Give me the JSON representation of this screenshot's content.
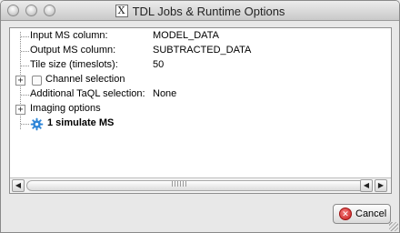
{
  "window": {
    "title": "TDL Jobs & Runtime Options",
    "title_icon": "X"
  },
  "tree": {
    "rows": [
      {
        "label": "Input MS column:",
        "value": "MODEL_DATA",
        "type": "leaf"
      },
      {
        "label": "Output MS column:",
        "value": "SUBTRACTED_DATA",
        "type": "leaf"
      },
      {
        "label": "Tile size (timeslots):",
        "value": "50",
        "type": "leaf"
      },
      {
        "label": "Channel selection",
        "type": "group-checkbox",
        "checked": false,
        "expander": "+"
      },
      {
        "label": "Additional TaQL selection:",
        "value": "None",
        "type": "leaf"
      },
      {
        "label": "Imaging options",
        "type": "group",
        "expander": "+"
      },
      {
        "label": "1 simulate MS",
        "type": "job",
        "icon": "gear-icon"
      }
    ]
  },
  "scrollbar": {
    "left_arrow": "◀",
    "right_arrow": "◀",
    "right_arrow_2": "▶"
  },
  "footer": {
    "cancel_label": "Cancel",
    "cancel_icon": "✕"
  },
  "colors": {
    "accent_gear": "#2f86d8",
    "cancel_red": "#c81d1d"
  }
}
